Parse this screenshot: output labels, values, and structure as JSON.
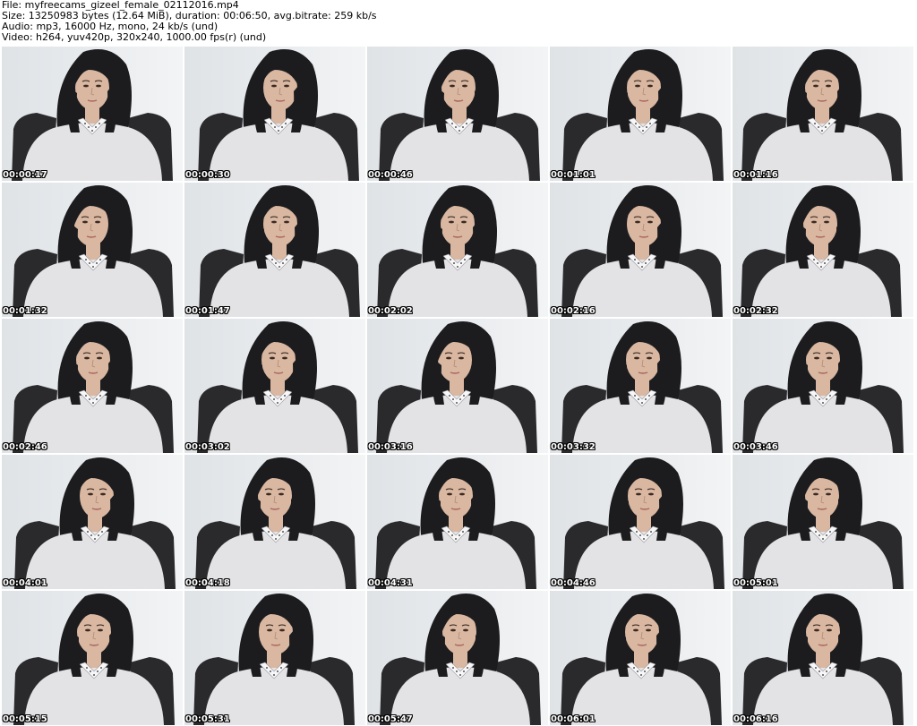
{
  "header": {
    "file_line": "File: myfreecams_gizeel_female_02112016.mp4",
    "size_line": "Size: 13250983 bytes (12.64 MiB), duration: 00:06:50, avg.bitrate: 259 kb/s",
    "audio_line": "Audio: mp3, 16000 Hz, mono, 24 kb/s (und)",
    "video_line": "Video: h264, yuv420p, 320x240, 1000.00 fps(r) (und)"
  },
  "thumbnails": [
    {
      "timestamp": "00:00:17"
    },
    {
      "timestamp": "00:00:30"
    },
    {
      "timestamp": "00:00:46"
    },
    {
      "timestamp": "00:01:01"
    },
    {
      "timestamp": "00:01:16"
    },
    {
      "timestamp": "00:01:32"
    },
    {
      "timestamp": "00:01:47"
    },
    {
      "timestamp": "00:02:02"
    },
    {
      "timestamp": "00:02:16"
    },
    {
      "timestamp": "00:02:32"
    },
    {
      "timestamp": "00:02:46"
    },
    {
      "timestamp": "00:03:02"
    },
    {
      "timestamp": "00:03:16"
    },
    {
      "timestamp": "00:03:32"
    },
    {
      "timestamp": "00:03:46"
    },
    {
      "timestamp": "00:04:01"
    },
    {
      "timestamp": "00:04:18"
    },
    {
      "timestamp": "00:04:31"
    },
    {
      "timestamp": "00:04:46"
    },
    {
      "timestamp": "00:05:01"
    },
    {
      "timestamp": "00:05:15"
    },
    {
      "timestamp": "00:05:31"
    },
    {
      "timestamp": "00:05:47"
    },
    {
      "timestamp": "00:06:01"
    },
    {
      "timestamp": "00:06:16"
    }
  ],
  "colors": {
    "background": "#ffffff",
    "wall": "#e8ebee",
    "hair": "#1c1c1e",
    "skin": "#d9b7a1",
    "sweater": "#e3e3e6",
    "chair": "#2a2a2c",
    "timestamp_text": "#ffffff"
  }
}
